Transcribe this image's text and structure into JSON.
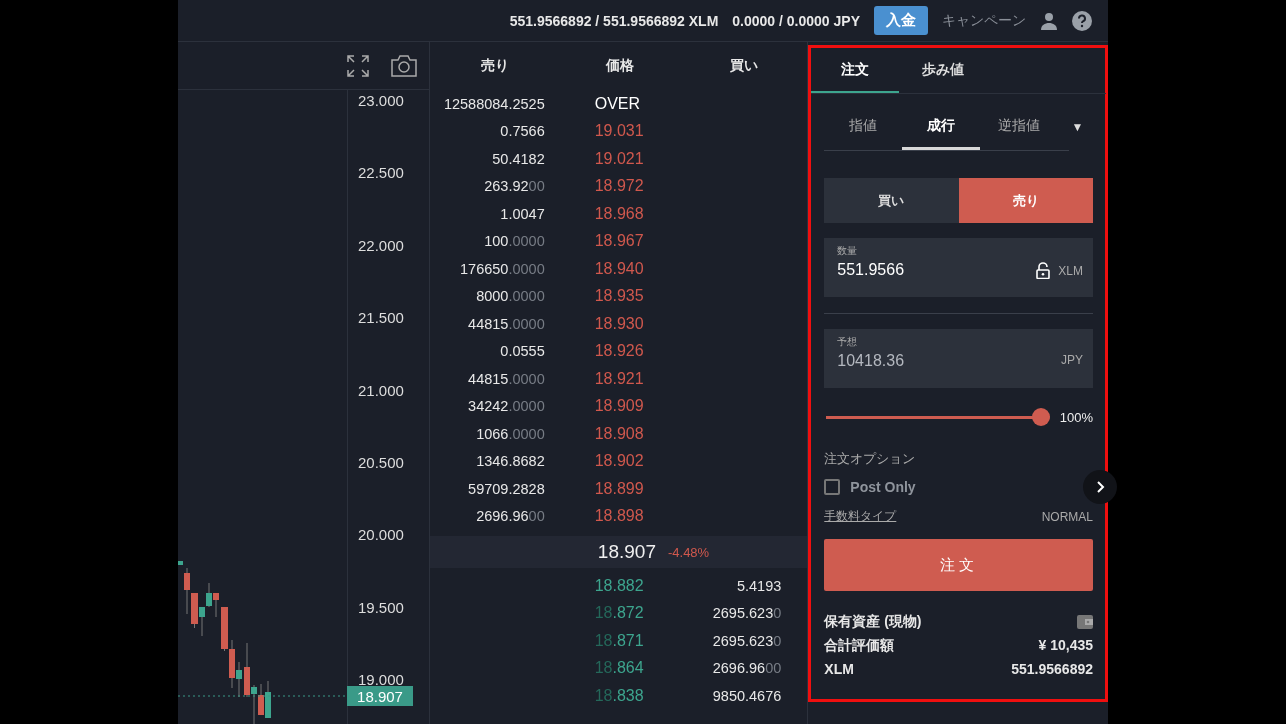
{
  "top_bar": {
    "balances": [
      "551.9566892 / 551.9566892 XLM",
      "0.0000 / 0.0000 JPY"
    ],
    "deposit_button": "入金",
    "campaign_link": "キャンペーン"
  },
  "chart": {
    "price_axis": [
      "23.000",
      "22.500",
      "22.000",
      "21.500",
      "21.000",
      "20.500",
      "20.000",
      "19.500",
      "19.000"
    ],
    "last_price_tag": "18.907"
  },
  "order_book": {
    "columns": [
      "売り",
      "価格",
      "買い"
    ],
    "asks": [
      {
        "kind": "over",
        "amount": "12588084.2525",
        "price": "OVER"
      },
      {
        "kind": "level",
        "amount": "0.7566",
        "price": "19.031"
      },
      {
        "kind": "level",
        "amount": "50.4182",
        "price": "19.021"
      },
      {
        "kind": "level",
        "amount": "263.92",
        "amount_dim": "00",
        "price": "18.972"
      },
      {
        "kind": "level",
        "amount": "1.0047",
        "price": "18.968"
      },
      {
        "kind": "level",
        "amount": "100",
        "amount_dim": ".0000",
        "price": "18.967"
      },
      {
        "kind": "level",
        "amount": "176650",
        "amount_dim": ".0000",
        "price": "18.940"
      },
      {
        "kind": "level",
        "amount": "8000",
        "amount_dim": ".0000",
        "price": "18.935"
      },
      {
        "kind": "level",
        "amount": "44815",
        "amount_dim": ".0000",
        "price": "18.930"
      },
      {
        "kind": "level",
        "amount": "0.0555",
        "price": "18.926"
      },
      {
        "kind": "level",
        "amount": "44815",
        "amount_dim": ".0000",
        "price": "18.921"
      },
      {
        "kind": "level",
        "amount": "34242",
        "amount_dim": ".0000",
        "price": "18.909"
      },
      {
        "kind": "level",
        "amount": "1066",
        "amount_dim": ".0000",
        "price": "18.908"
      },
      {
        "kind": "level",
        "amount": "1346.8682",
        "price": "18.902"
      },
      {
        "kind": "level",
        "amount": "59709.2828",
        "price": "18.899"
      },
      {
        "kind": "level",
        "amount": "2696.96",
        "amount_dim": "00",
        "price": "18.898"
      }
    ],
    "mid": {
      "price": "18.907",
      "change": "-4.48%"
    },
    "bids": [
      {
        "price": "18.882",
        "amount": "5.4193"
      },
      {
        "price_dim": "18",
        "price": ".872",
        "amount": "2695.623",
        "amount_dim": "0"
      },
      {
        "price_dim": "18",
        "price": ".871",
        "amount": "2695.623",
        "amount_dim": "0"
      },
      {
        "price_dim": "18",
        "price": ".864",
        "amount": "2696.96",
        "amount_dim": "00"
      },
      {
        "price_dim": "18",
        "price": ".838",
        "amount": "9850.4676"
      }
    ]
  },
  "order_panel": {
    "tabs": [
      {
        "label": "注文",
        "selected": true
      },
      {
        "label": "歩み値",
        "selected": false
      }
    ],
    "order_types": [
      {
        "label": "指値",
        "selected": false
      },
      {
        "label": "成行",
        "selected": true
      },
      {
        "label": "逆指値",
        "selected": false
      }
    ],
    "order_type_dropdown": "▼",
    "sides": [
      {
        "kind": "buy",
        "label": "買い",
        "selected": false
      },
      {
        "kind": "sell",
        "label": "売り",
        "selected": true
      }
    ],
    "quantity_field": {
      "label": "数量",
      "value": "551.9566",
      "unit": "XLM",
      "disabled": false
    },
    "estimate_field": {
      "label": "予想",
      "value": "10418.36",
      "unit": "JPY",
      "disabled": true
    },
    "slider": {
      "level": 1,
      "reading": "100%"
    },
    "options": {
      "title": "注文オプション",
      "post_only": {
        "label": "Post Only",
        "checked": false
      }
    },
    "fee": {
      "link": "手数料タイプ",
      "value": "NORMAL"
    },
    "submit_button": "注文",
    "holdings": {
      "title": "保有資産 (現物)",
      "rows": [
        {
          "label": "合計評価額",
          "value": "¥ 10,435"
        },
        {
          "label": "XLM",
          "value": "551.9566892"
        }
      ]
    }
  }
}
